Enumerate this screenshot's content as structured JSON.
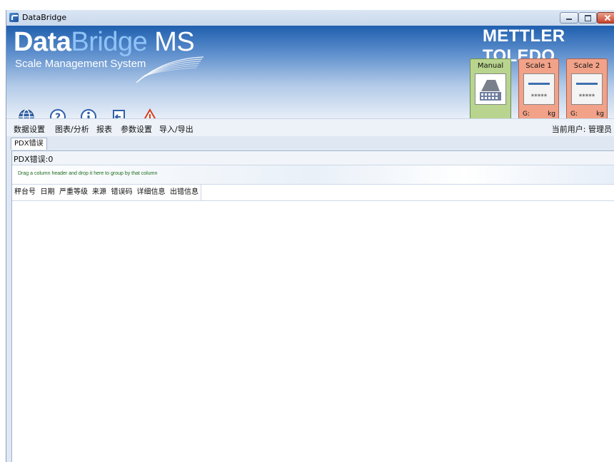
{
  "window": {
    "title": "DataBridge"
  },
  "banner": {
    "logo_data": "Data",
    "logo_bridge": "Bridge",
    "logo_ms": " MS",
    "subtitle": "Scale Management System",
    "brand": "METTLER TOLEDO"
  },
  "toolbar_icons": [
    "globe-icon",
    "help-icon",
    "info-icon",
    "exit-icon",
    "warning-icon"
  ],
  "scales": [
    {
      "label": "Manual"
    },
    {
      "label": "Scale 1",
      "display": "*****",
      "g_label": "G:",
      "unit": "kg"
    },
    {
      "label": "Scale 2",
      "display": "*****",
      "g_label": "G:",
      "unit": "kg"
    }
  ],
  "menu": {
    "items": [
      "数据设置",
      "图表/分析",
      "报表",
      "参数设置",
      "导入/导出"
    ],
    "current_user": "当前用户: 管理员"
  },
  "tabs": [
    {
      "label": "PDX错误"
    }
  ],
  "grid": {
    "count_label": "PDX错误:0",
    "group_hint": "Drag a column header and drop it here to group by that column",
    "columns": [
      "秤台号",
      "日期",
      "严重等级",
      "来源",
      "错误码",
      "详细信息",
      "出错信息"
    ]
  },
  "colors": {
    "banner_top": "#1f5fae",
    "manual_card": "#b8d48e",
    "scale_card": "#f1a288",
    "hint_text": "#1c6b1c"
  }
}
